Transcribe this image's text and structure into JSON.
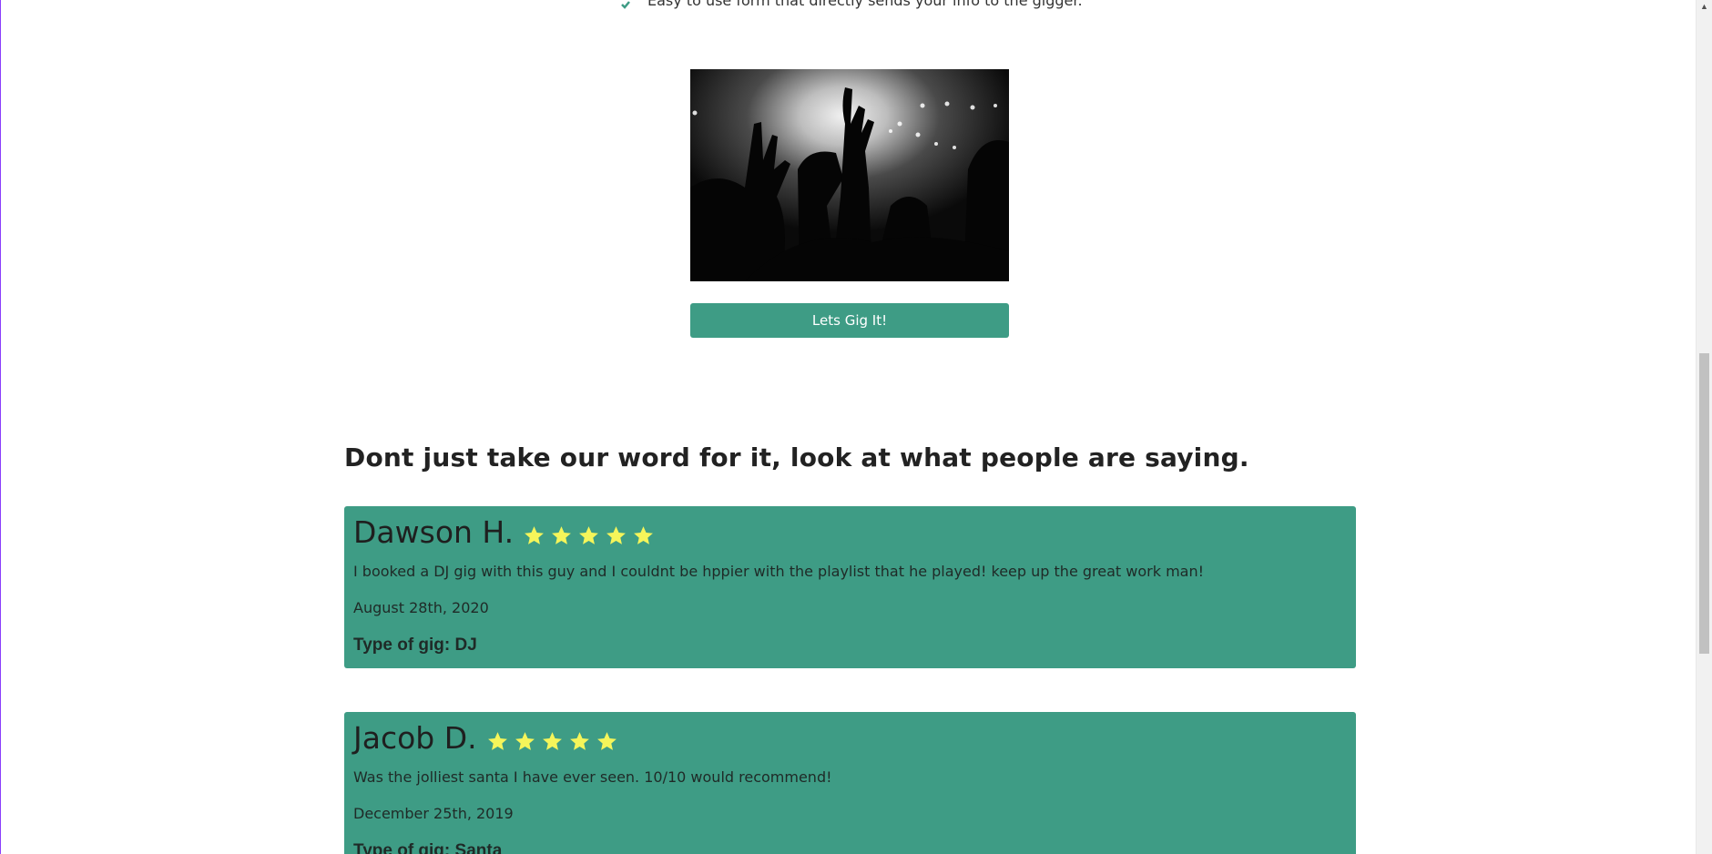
{
  "feature": {
    "text": "Easy to use form that directly sends your info to the gigger.",
    "icon": "check-icon"
  },
  "hero": {
    "image_icon": "concert-crowd-image"
  },
  "cta": {
    "label": "Lets Gig It!"
  },
  "reviews_section": {
    "heading": "Dont just take our word for it, look at what people are saying."
  },
  "reviews": [
    {
      "name": "Dawson H.",
      "rating": 5,
      "text": "I booked a DJ gig with this guy and I couldnt be hppier with the playlist that he played! keep up the great work man!",
      "date": "August 28th, 2020",
      "type": "Type of gig: DJ"
    },
    {
      "name": "Jacob D.",
      "rating": 5,
      "text": "Was the jolliest santa I have ever seen. 10/10 would recommend!",
      "date": "December 25th, 2019",
      "type": "Type of gig: Santa"
    }
  ],
  "colors": {
    "accent": "#3e9c85",
    "star": "#f5f55a",
    "text": "#222222"
  }
}
